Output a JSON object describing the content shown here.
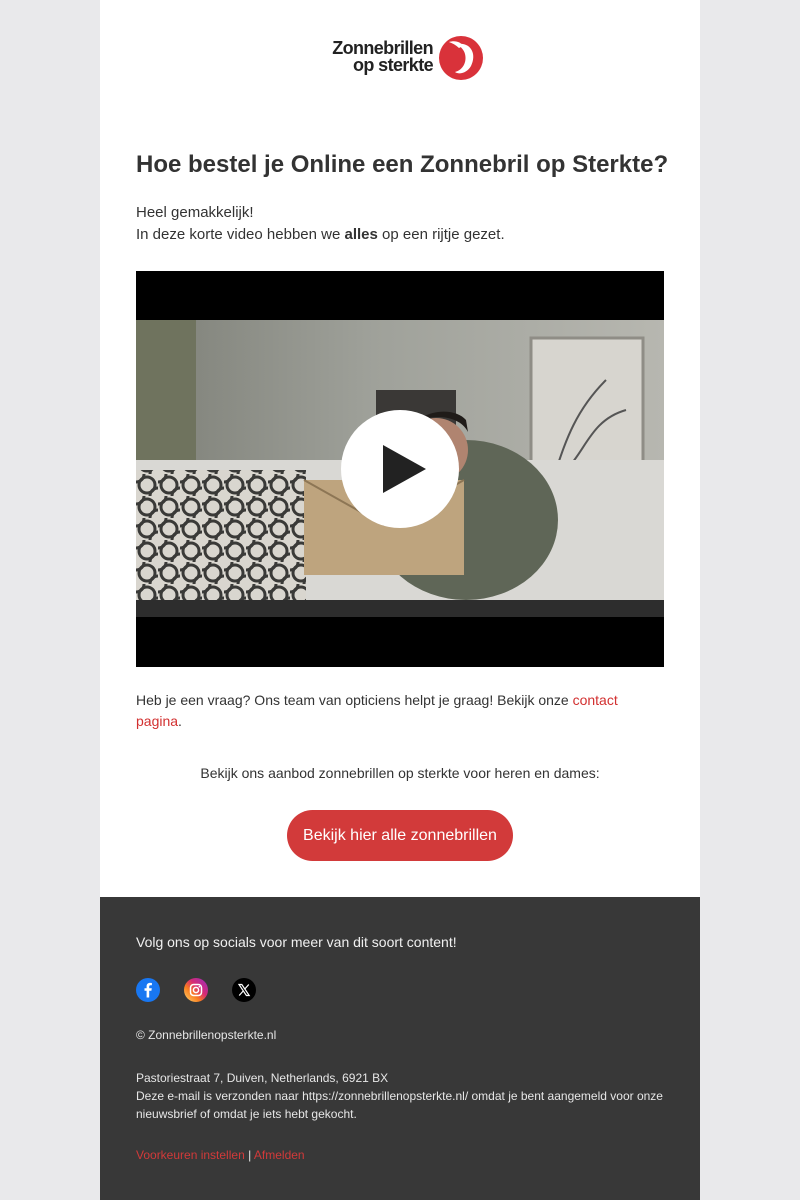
{
  "logo": {
    "line1": "Zonnebrillen",
    "line2": "op sterkte",
    "brand_color": "#d9323a"
  },
  "heading": "Hoe bestel je Online een Zonnebril op Sterkte?",
  "intro": {
    "line1": "Heel gemakkelijk!",
    "line2_before": "In deze korte video hebben we ",
    "line2_bold": "alles",
    "line2_after": " op een rijtje gezet."
  },
  "video": {
    "play_icon": "play-icon"
  },
  "question": {
    "text": "Heb je een vraag? Ons team van opticiens helpt je graag! Bekijk onze ",
    "link": "contact pagina",
    "after": "."
  },
  "offer_text": "Bekijk ons aanbod zonnebrillen op sterkte voor heren en dames:",
  "cta_label": "Bekijk hier alle zonnebrillen",
  "footer": {
    "follow_text": "Volg ons op socials voor meer van dit soort content!",
    "socials": [
      "facebook-icon",
      "instagram-icon",
      "x-icon"
    ],
    "copyright": "© Zonnebrillenopsterkte.nl",
    "address": "Pastoriestraat 7, Duiven, Netherlands, 6921 BX",
    "notice": "Deze e-mail is verzonden naar https://zonnebrillenopsterkte.nl/ omdat je bent aangemeld voor onze nieuwsbrief of omdat je iets hebt gekocht.",
    "preferences_link": "Voorkeuren instellen",
    "separator": "|",
    "unsubscribe_link": "Afmelden"
  },
  "colors": {
    "accent": "#d23a3a",
    "footer_bg": "#383838",
    "page_bg": "#e9e9eb"
  }
}
